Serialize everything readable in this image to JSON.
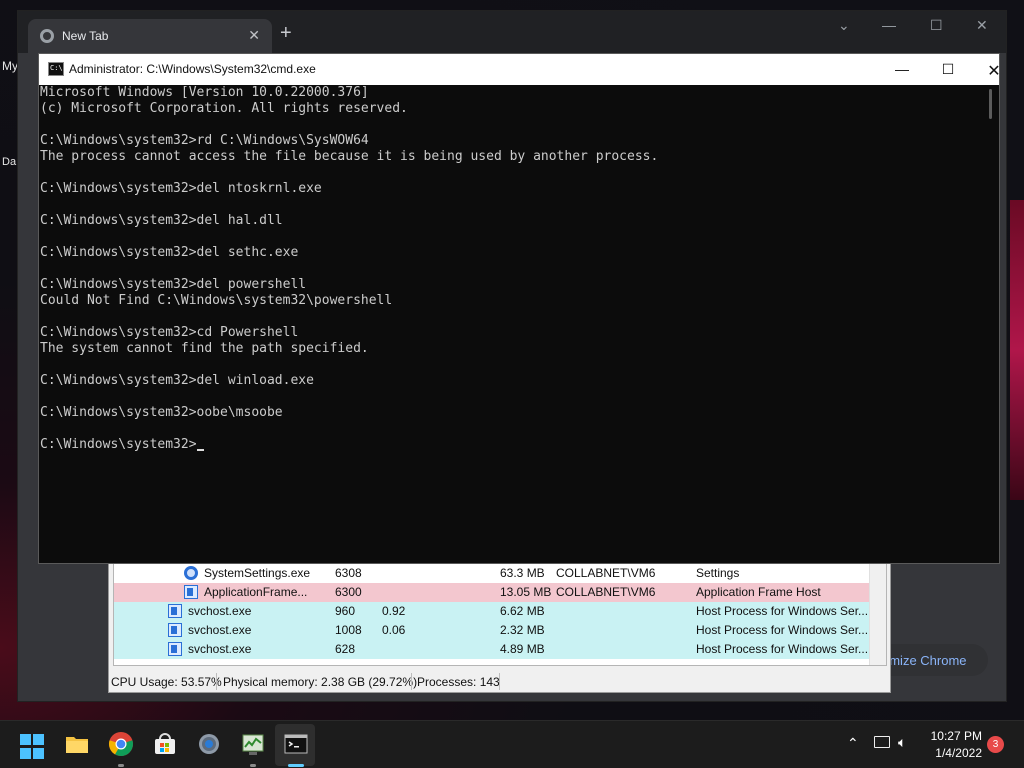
{
  "desktop": {
    "label_1": "My",
    "label_2": "Da"
  },
  "chrome": {
    "tab_title": "New Tab",
    "new_tab": "+",
    "customize_label": "omize Chrome"
  },
  "cmd": {
    "title": "Administrator: C:\\Windows\\System32\\cmd.exe",
    "lines": [
      "Microsoft Windows [Version 10.0.22000.376]",
      "(c) Microsoft Corporation. All rights reserved.",
      "",
      "C:\\Windows\\system32>rd C:\\Windows\\SysWOW64",
      "The process cannot access the file because it is being used by another process.",
      "",
      "C:\\Windows\\system32>del ntoskrnl.exe",
      "",
      "C:\\Windows\\system32>del hal.dll",
      "",
      "C:\\Windows\\system32>del sethc.exe",
      "",
      "C:\\Windows\\system32>del powershell",
      "Could Not Find C:\\Windows\\system32\\powershell",
      "",
      "C:\\Windows\\system32>cd Powershell",
      "The system cannot find the path specified.",
      "",
      "C:\\Windows\\system32>del winload.exe",
      "",
      "C:\\Windows\\system32>oobe\\msoobe",
      "",
      "C:\\Windows\\system32>"
    ]
  },
  "task_manager": {
    "rows": [
      {
        "name": "SystemSettings.exe",
        "pid": "6308",
        "cpu": "",
        "memory": "63.3 MB",
        "user": "COLLABNET\\VM6",
        "description": "Settings",
        "bg": "#ffffff",
        "indent": true,
        "icon": "gear-icon"
      },
      {
        "name": "ApplicationFrame...",
        "pid": "6300",
        "cpu": "",
        "memory": "13.05 MB",
        "user": "COLLABNET\\VM6",
        "description": "Application Frame Host",
        "bg": "#f3c7cf",
        "indent": true,
        "icon": "window-icon"
      },
      {
        "name": "svchost.exe",
        "pid": "960",
        "cpu": "0.92",
        "memory": "6.62 MB",
        "user": "",
        "description": "Host Process for Windows Ser...",
        "bg": "#c9f2f3",
        "indent": false,
        "icon": "window-icon"
      },
      {
        "name": "svchost.exe",
        "pid": "1008",
        "cpu": "0.06",
        "memory": "2.32 MB",
        "user": "",
        "description": "Host Process for Windows Ser...",
        "bg": "#c9f2f3",
        "indent": false,
        "icon": "window-icon"
      },
      {
        "name": "svchost.exe",
        "pid": "628",
        "cpu": "",
        "memory": "4.89 MB",
        "user": "",
        "description": "Host Process for Windows Ser...",
        "bg": "#c9f2f3",
        "indent": false,
        "icon": "window-icon"
      }
    ],
    "status": {
      "cpu": "CPU Usage: 53.57%",
      "memory": "Physical memory: 2.38 GB (29.72%)",
      "processes": "Processes: 143"
    }
  },
  "taskbar": {
    "icons": [
      "start-icon",
      "file-explorer-icon",
      "chrome-icon",
      "store-icon",
      "settings-icon",
      "task-manager-icon",
      "terminal-icon"
    ],
    "time": "10:27 PM",
    "date": "1/4/2022",
    "notification_count": "3"
  }
}
